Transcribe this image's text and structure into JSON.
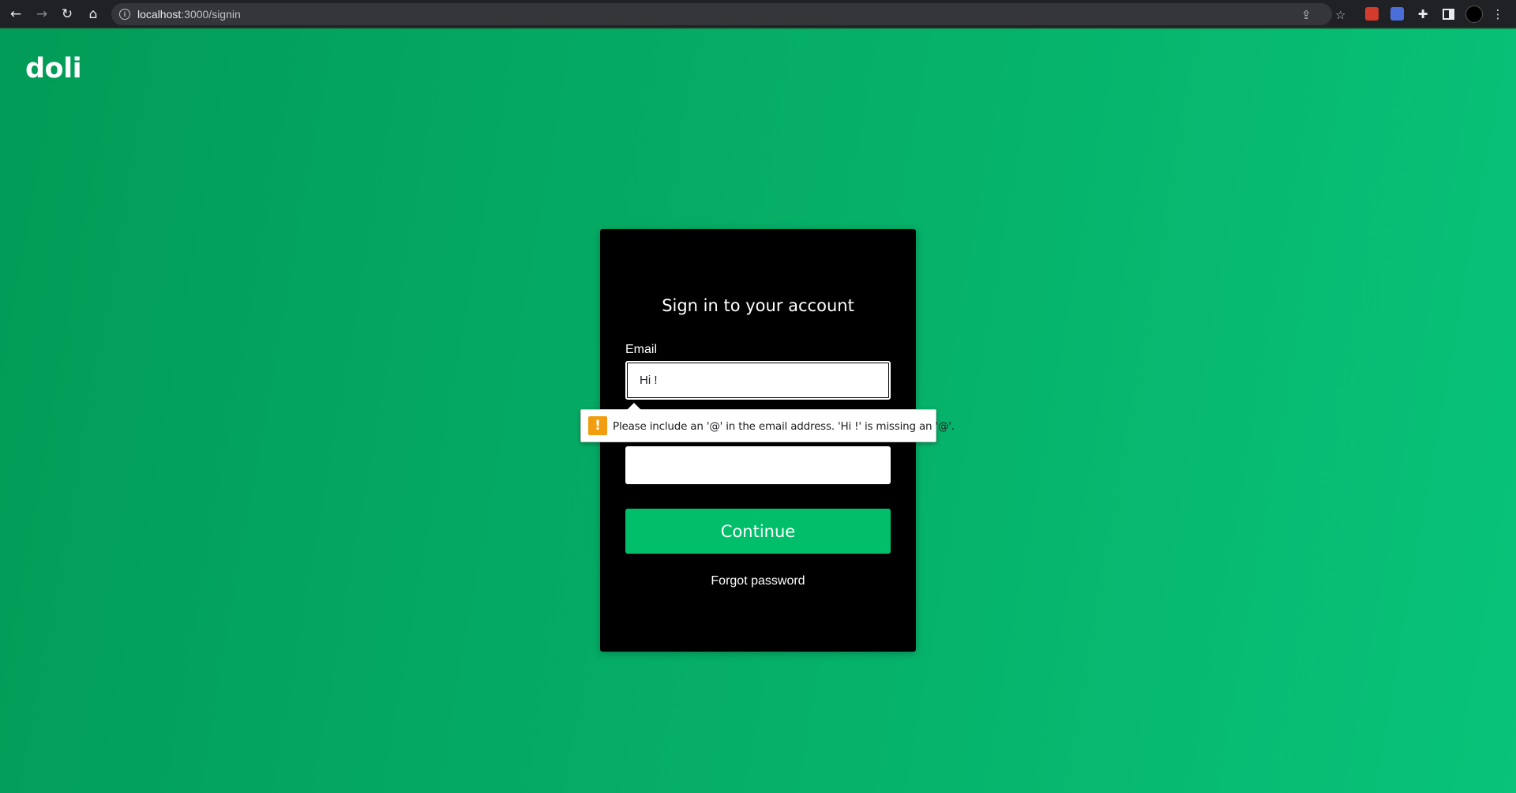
{
  "browser": {
    "url_host": "localhost",
    "url_path": ":3000/signin",
    "icons": {
      "back": "back-arrow-icon",
      "forward": "forward-arrow-icon",
      "reload": "reload-icon",
      "home": "home-icon",
      "share": "share-icon",
      "bookmark": "star-icon",
      "extensions": "puzzle-icon",
      "menu": "kebab-menu-icon"
    }
  },
  "page": {
    "logo": "doli",
    "card_title": "Sign in to your account",
    "email_label": "Email",
    "email_value": "Hi !",
    "password_value": "",
    "continue_label": "Continue",
    "forgot_label": "Forgot password",
    "colors": {
      "background": "#019c57",
      "card": "#000000",
      "button": "#00be6a"
    }
  },
  "validation": {
    "message": "Please include an '@' in the email address. 'Hi !' is missing an '@'.",
    "icon": "warning-icon",
    "icon_glyph": "!"
  }
}
